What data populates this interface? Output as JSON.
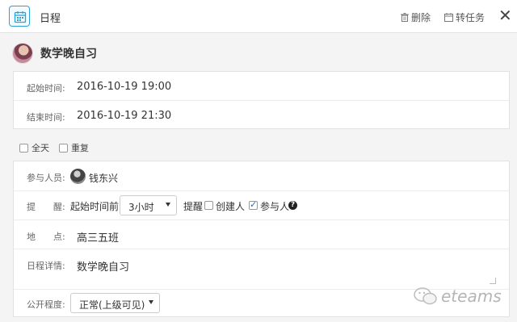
{
  "header": {
    "calendar_icon": "calendar-icon",
    "title": "日程",
    "delete_label": "删除",
    "convert_label": "转任务",
    "close_glyph": "✕"
  },
  "schedule": {
    "title": "数学晚自习"
  },
  "times": {
    "start_label": "起始时间:",
    "start_value": "2016-10-19 19:00",
    "end_label": "结束时间:",
    "end_value": "2016-10-19 21:30"
  },
  "options": {
    "all_day_label": "全天",
    "all_day_checked": false,
    "repeat_label": "重复",
    "repeat_checked": false
  },
  "details": {
    "participants_label": "参与人员:",
    "participant_name": "钱东兴",
    "reminder_label": "提　　醒:",
    "reminder_prefix": "起始时间前",
    "reminder_select": "3小时",
    "reminder_word": "提醒",
    "creator_label": "创建人",
    "creator_checked": false,
    "participant_opt_label": "参与人",
    "participant_opt_checked": true,
    "help_glyph": "?",
    "location_label": "地　　点:",
    "location_value": "高三五班",
    "detail_label": "日程详情:",
    "detail_value": "数学晚自习",
    "visibility_label": "公开程度:",
    "visibility_select": "正常(上级可见)"
  },
  "watermark": {
    "text": "eteams"
  },
  "colors": {
    "accent": "#29a3d6",
    "checkbox_check": "#2a6fb8"
  }
}
